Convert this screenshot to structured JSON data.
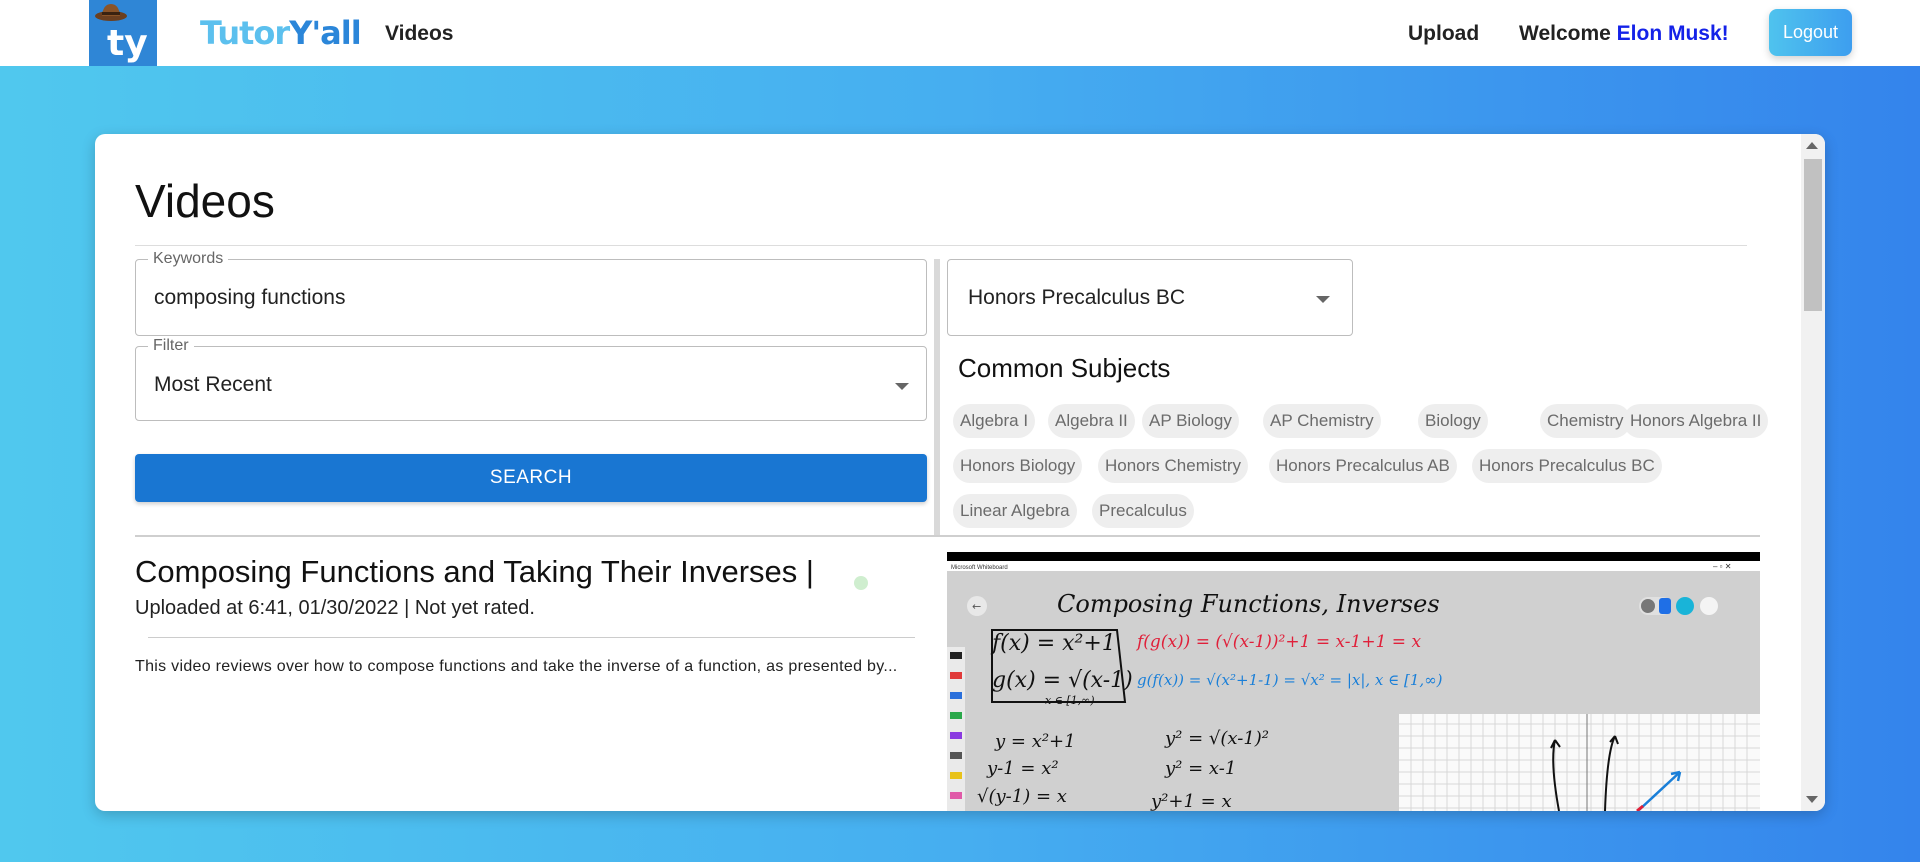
{
  "nav": {
    "brand_part1": "Tutor",
    "brand_part2": "Y'all",
    "videos_link": "Videos",
    "upload_link": "Upload",
    "welcome_prefix": "Welcome ",
    "user_name": "Elon Musk!",
    "logout_label": "Logout",
    "logo_text": "ty"
  },
  "page": {
    "title": "Videos"
  },
  "search": {
    "keywords_label": "Keywords",
    "keywords_value": "composing functions",
    "filter_label": "Filter",
    "filter_value": "Most Recent",
    "subject_value": "Honors Precalculus BC",
    "search_button": "SEARCH"
  },
  "subjects": {
    "title": "Common Subjects",
    "items": [
      "Algebra I",
      "Algebra II",
      "AP Biology",
      "AP Chemistry",
      "Biology",
      "Chemistry",
      "Honors Algebra II",
      "Honors Biology",
      "Honors Chemistry",
      "Honors Precalculus AB",
      "Honors Precalculus BC",
      "Linear Algebra",
      "Precalculus"
    ]
  },
  "video": {
    "title": "Composing Functions and Taking Their Inverses |",
    "meta": "Uploaded at 6:41, 01/30/2022 | Not yet rated.",
    "description": "This video reviews over how to compose functions and take the inverse of a function, as presented by...",
    "thumbnail": {
      "window_title": "Microsoft Whiteboard",
      "heading": "Composing Functions, Inverses",
      "f_def": "f(x) = x²+1",
      "g_def": "g(x) = √(x-1)",
      "g_domain": "x ∈ [1,∞)",
      "fog": "f(g(x)) = (√(x-1))²+1 = x-1+1 = x",
      "gof": "g(f(x)) = √(x²+1-1) = √x² = |x|, x ∈ [1,∞)",
      "step1": "y = x²+1",
      "step2": "y-1 = x²",
      "step3": "√(y-1) = x",
      "inv1": "y² = √(x-1)²",
      "inv2": "y² = x-1",
      "inv3": "y²+1 = x"
    }
  },
  "colors": {
    "accent": "#1976d2",
    "brand_light": "#5cc0ee",
    "brand_dark": "#2b86d9",
    "username": "#1422e8",
    "thumb_red": "#e0203a",
    "thumb_blue": "#1a7fd8"
  }
}
